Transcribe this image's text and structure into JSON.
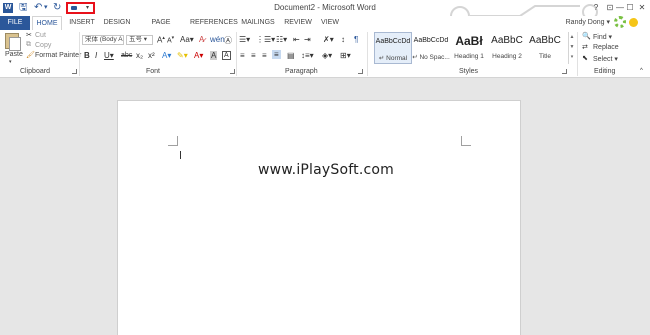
{
  "titlebar": {
    "document_title": "Document2 - Microsoft Word",
    "help": "?",
    "ribbon_display": "⊡",
    "minimize": "—",
    "maximize": "☐",
    "close": "✕"
  },
  "tabs": [
    {
      "label": "FILE"
    },
    {
      "label": "HOME"
    },
    {
      "label": "INSERT"
    },
    {
      "label": "DESIGN"
    },
    {
      "label": "PAGE LAYOUT"
    },
    {
      "label": "REFERENCES"
    },
    {
      "label": "MAILINGS"
    },
    {
      "label": "REVIEW"
    },
    {
      "label": "VIEW"
    }
  ],
  "user": {
    "name": "Randy Dong ▾"
  },
  "clipboard": {
    "paste_label": "Paste",
    "cut_label": "Cut",
    "copy_label": "Copy",
    "format_painter_label": "Format Painter",
    "group_label": "Clipboard"
  },
  "font": {
    "font_name": "宋体 (Body A ▾",
    "font_size": "五号 ▾",
    "group_label": "Font"
  },
  "paragraph": {
    "group_label": "Paragraph"
  },
  "styles": {
    "group_label": "Styles",
    "items": [
      {
        "sample": "AaBbCcDd",
        "name": "↵ Normal"
      },
      {
        "sample": "AaBbCcDd",
        "name": "↵ No Spac..."
      },
      {
        "sample": "AaBł",
        "name": "Heading 1"
      },
      {
        "sample": "AaBbC",
        "name": "Heading 2"
      },
      {
        "sample": "AaBbC",
        "name": "Title"
      }
    ]
  },
  "editing": {
    "find_label": "Find ▾",
    "replace_label": "Replace",
    "select_label": "Select ▾",
    "group_label": "Editing"
  },
  "document": {
    "watermark_text": "www.iPlaySoft.com"
  }
}
